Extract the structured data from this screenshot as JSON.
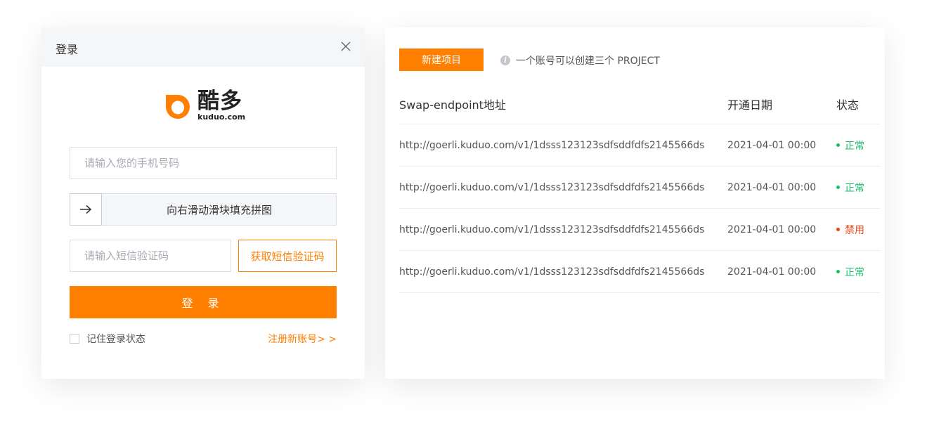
{
  "login": {
    "title": "登录",
    "logo": {
      "cn": "酷多",
      "en": "kuduo.com"
    },
    "phone_placeholder": "请输入您的手机号码",
    "slider_text": "向右滑动滑块填充拼图",
    "code_placeholder": "请输入短信验证码",
    "get_code_label": "获取短信验证码",
    "login_label": "登 录",
    "remember_label": "记住登录状态",
    "register_label": "注册新账号> >"
  },
  "projects": {
    "new_button": "新建项目",
    "tip": "一个账号可以创建三个 PROJECT",
    "columns": [
      "Swap-endpoint地址",
      "开通日期",
      "状态"
    ],
    "rows": [
      {
        "endpoint": "http://goerli.kuduo.com/v1/1dsss123123sdfsddfdfs2145566ds",
        "date": "2021-04-01 00:00",
        "status": "正常",
        "status_color": "#19be6b"
      },
      {
        "endpoint": "http://goerli.kuduo.com/v1/1dsss123123sdfsddfdfs2145566ds",
        "date": "2021-04-01 00:00",
        "status": "正常",
        "status_color": "#19be6b"
      },
      {
        "endpoint": "http://goerli.kuduo.com/v1/1dsss123123sdfsddfdfs2145566ds",
        "date": "2021-04-01 00:00",
        "status": "禁用",
        "status_color": "#ed4014"
      },
      {
        "endpoint": "http://goerli.kuduo.com/v1/1dsss123123sdfsddfdfs2145566ds",
        "date": "2021-04-01 00:00",
        "status": "正常",
        "status_color": "#19be6b"
      }
    ]
  },
  "colors": {
    "accent": "#ff7f00",
    "ok": "#19be6b",
    "disabled": "#ed4014"
  },
  "icons": [
    "close-icon",
    "kuduo-logo-icon",
    "arrow-right-icon",
    "info-icon"
  ]
}
